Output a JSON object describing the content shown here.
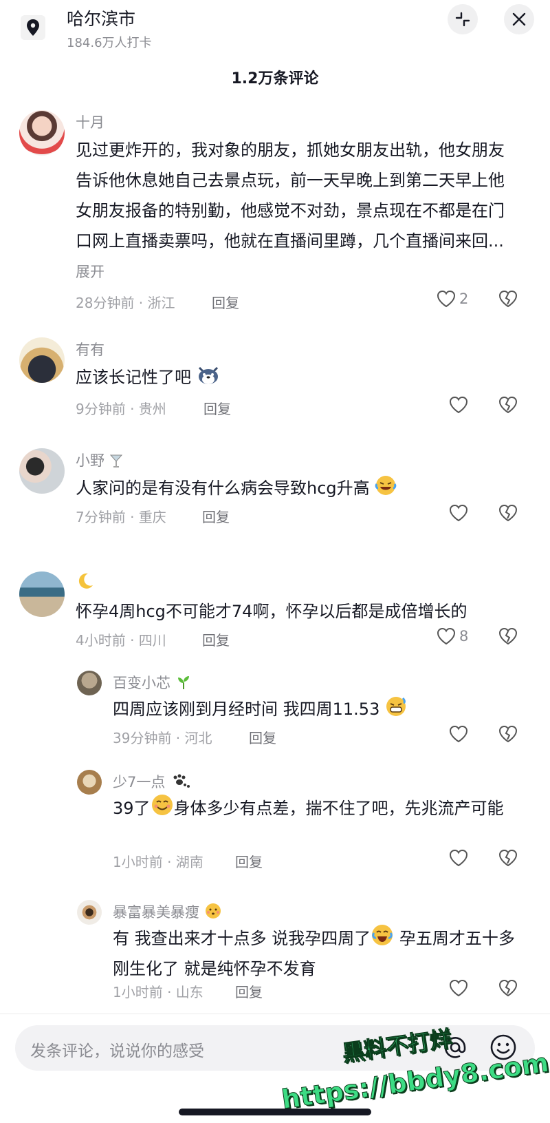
{
  "header": {
    "location_title": "哈尔滨市",
    "location_subtitle": "184.6万人打卡",
    "comment_count": "1.2万条评论"
  },
  "icons": {
    "location": "map-pin-icon",
    "collapse": "collapse-icon",
    "close": "close-icon",
    "like": "heart-icon",
    "dislike": "broken-heart-icon",
    "at": "at-icon",
    "emoji": "emoji-icon"
  },
  "comments": [
    {
      "username": "十月",
      "text": "见过更炸开的，我对象的朋友，抓她女朋友出轨，他女朋友告诉他休息她自己去景点玩，前一天早晚上到第二天早上他女朋友报备的特别勤，他感觉不对劲，景点现在不都是在门口网上直播卖票吗，他就在直播间里蹲，几个直播间来回...",
      "expand": "展开",
      "meta": "28分钟前 · 浙江",
      "reply": "回复",
      "likes": "2"
    },
    {
      "username": "有有",
      "text": "应该长记性了吧",
      "meta": "9分钟前 · 贵州",
      "reply": "回复",
      "likes": ""
    },
    {
      "username": "小野",
      "text": "人家问的是有没有什么病会导致hcg升高",
      "meta": "7分钟前 · 重庆",
      "reply": "回复",
      "likes": ""
    },
    {
      "username": "",
      "text": "怀孕4周hcg不可能才74啊，怀孕以后都是成倍增长的",
      "meta": "4小时前 · 四川",
      "reply": "回复",
      "likes": "8"
    }
  ],
  "replies": [
    {
      "username": "百变小芯",
      "text": "四周应该刚到月经时间 我四周11.53",
      "meta": "39分钟前 · 河北",
      "reply": "回复"
    },
    {
      "username": "少7一点",
      "text_a": "39了",
      "text_b": "身体多少有点差，揣不住了吧，先兆流产可能",
      "meta": "1小时前 · 湖南",
      "reply": "回复"
    },
    {
      "username": "暴富暴美暴瘦",
      "text_a": "有 我查出来才十点多  说我孕四周了",
      "text_b": " 孕五周才五十多  刚生化了 就是纯怀孕不发育",
      "meta": "1小时前 · 山东",
      "reply": "回复"
    }
  ],
  "input": {
    "placeholder": "发条评论，说说你的感受"
  },
  "watermark": {
    "line1": "黑料不打烊",
    "line2": "https://bbdy8.com"
  }
}
